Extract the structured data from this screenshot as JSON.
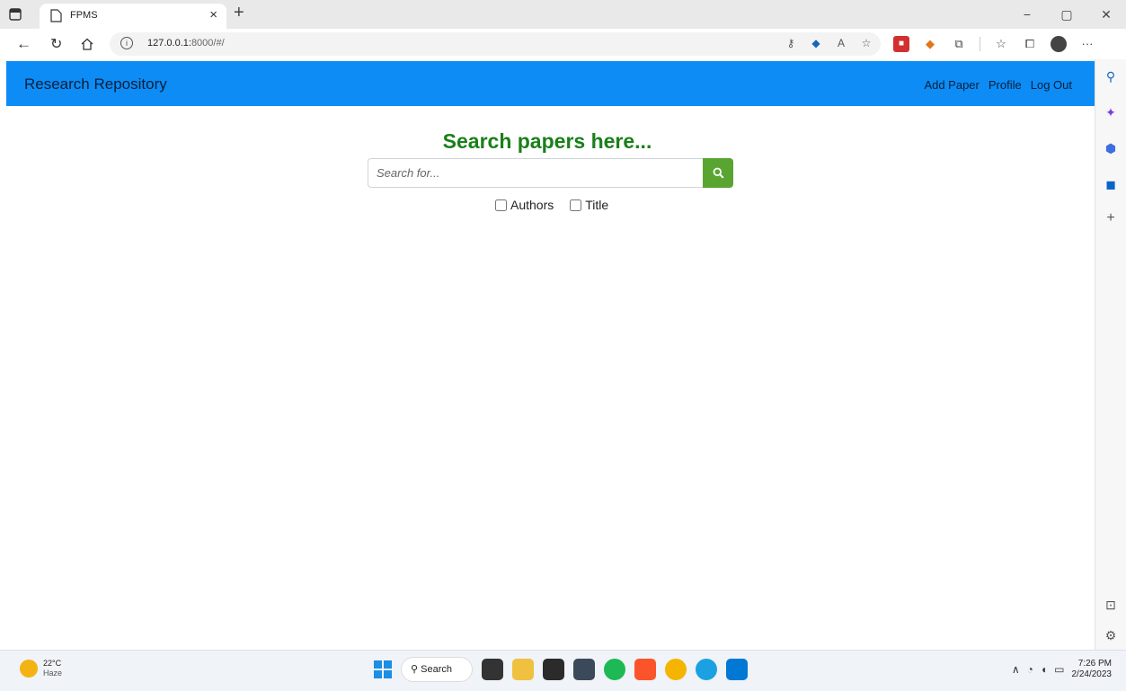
{
  "browser": {
    "tab_title": "FPMS",
    "tab_close": "×",
    "new_tab": "+",
    "url_host": "127.0.0.1:",
    "url_path": "8000/#/",
    "window_controls": [
      "−",
      "▢",
      "✕"
    ],
    "more_menu": "···"
  },
  "navbar": {
    "brand": "Research Repository",
    "links": [
      "Add Paper",
      "Profile",
      "Log Out"
    ],
    "color": "#0d8cf6"
  },
  "search": {
    "heading": "Search papers here...",
    "placeholder": "Search for...",
    "button_icon": "search-icon",
    "options": [
      "Authors",
      "Title"
    ]
  },
  "taskbar": {
    "temperature": "22°C",
    "condition": "Haze",
    "search_label": "Search",
    "time": "7:26 PM",
    "date": "2/24/2023"
  },
  "colors": {
    "heading": "#1a7f1a",
    "search_button": "#5aa532"
  }
}
